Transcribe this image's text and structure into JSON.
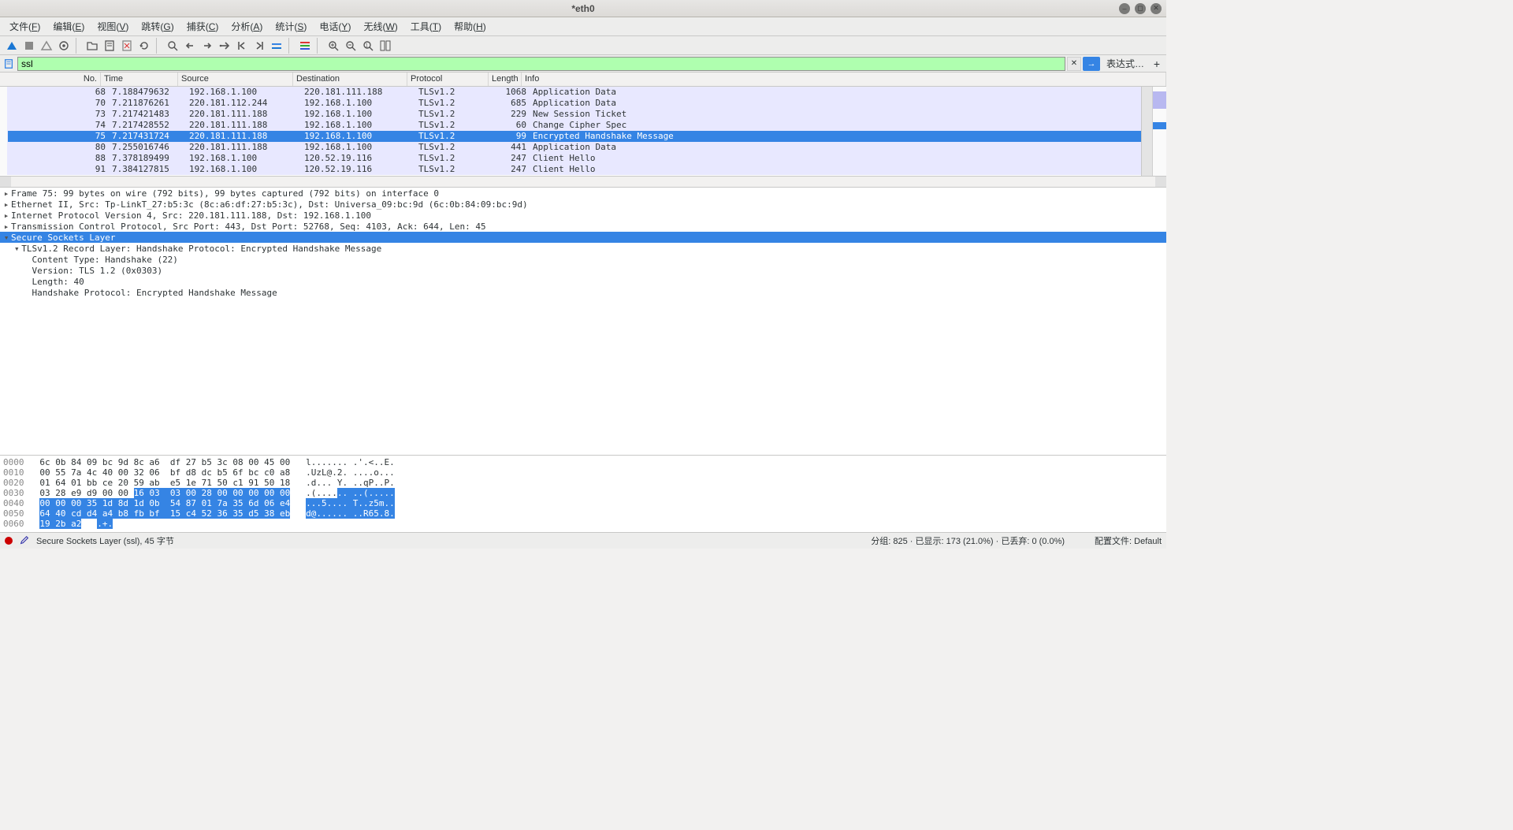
{
  "window": {
    "title": "*eth0"
  },
  "menu": [
    "文件(F)",
    "编辑(E)",
    "视图(V)",
    "跳转(G)",
    "捕获(C)",
    "分析(A)",
    "统计(S)",
    "电话(Y)",
    "无线(W)",
    "工具(T)",
    "帮助(H)"
  ],
  "filter": {
    "value": "ssl",
    "expr_label": "表达式…"
  },
  "packet_headers": [
    "No.",
    "Time",
    "Source",
    "Destination",
    "Protocol",
    "Length",
    "Info"
  ],
  "packets": [
    {
      "no": "68",
      "time": "7.188479632",
      "src": "192.168.1.100",
      "dst": "220.181.111.188",
      "proto": "TLSv1.2",
      "len": "1068",
      "info": "Application Data"
    },
    {
      "no": "70",
      "time": "7.211876261",
      "src": "220.181.112.244",
      "dst": "192.168.1.100",
      "proto": "TLSv1.2",
      "len": "685",
      "info": "Application Data"
    },
    {
      "no": "73",
      "time": "7.217421483",
      "src": "220.181.111.188",
      "dst": "192.168.1.100",
      "proto": "TLSv1.2",
      "len": "229",
      "info": "New Session Ticket"
    },
    {
      "no": "74",
      "time": "7.217428552",
      "src": "220.181.111.188",
      "dst": "192.168.1.100",
      "proto": "TLSv1.2",
      "len": "60",
      "info": "Change Cipher Spec"
    },
    {
      "no": "75",
      "time": "7.217431724",
      "src": "220.181.111.188",
      "dst": "192.168.1.100",
      "proto": "TLSv1.2",
      "len": "99",
      "info": "Encrypted Handshake Message",
      "selected": true
    },
    {
      "no": "80",
      "time": "7.255016746",
      "src": "220.181.111.188",
      "dst": "192.168.1.100",
      "proto": "TLSv1.2",
      "len": "441",
      "info": "Application Data"
    },
    {
      "no": "88",
      "time": "7.378189499",
      "src": "192.168.1.100",
      "dst": "120.52.19.116",
      "proto": "TLSv1.2",
      "len": "247",
      "info": "Client Hello"
    },
    {
      "no": "91",
      "time": "7.384127815",
      "src": "192.168.1.100",
      "dst": "120.52.19.116",
      "proto": "TLSv1.2",
      "len": "247",
      "info": "Client Hello"
    }
  ],
  "details": [
    {
      "ind": 0,
      "tw": "▸",
      "text": "Frame 75: 99 bytes on wire (792 bits), 99 bytes captured (792 bits) on interface 0"
    },
    {
      "ind": 0,
      "tw": "▸",
      "text": "Ethernet II, Src: Tp-LinkT_27:b5:3c (8c:a6:df:27:b5:3c), Dst: Universa_09:bc:9d (6c:0b:84:09:bc:9d)"
    },
    {
      "ind": 0,
      "tw": "▸",
      "text": "Internet Protocol Version 4, Src: 220.181.111.188, Dst: 192.168.1.100"
    },
    {
      "ind": 0,
      "tw": "▸",
      "text": "Transmission Control Protocol, Src Port: 443, Dst Port: 52768, Seq: 4103, Ack: 644, Len: 45"
    },
    {
      "ind": 0,
      "tw": "▾",
      "text": "Secure Sockets Layer",
      "sel": true
    },
    {
      "ind": 1,
      "tw": "▾",
      "text": "TLSv1.2 Record Layer: Handshake Protocol: Encrypted Handshake Message"
    },
    {
      "ind": 2,
      "tw": " ",
      "text": "Content Type: Handshake (22)"
    },
    {
      "ind": 2,
      "tw": " ",
      "text": "Version: TLS 1.2 (0x0303)"
    },
    {
      "ind": 2,
      "tw": " ",
      "text": "Length: 40"
    },
    {
      "ind": 2,
      "tw": " ",
      "text": "Handshake Protocol: Encrypted Handshake Message"
    }
  ],
  "bytes": [
    {
      "off": "0000",
      "hex": [
        "6c 0b 84 09 bc 9d 8c a6  df 27 b5 3c 08 00 45 00"
      ],
      "ascii": "l....... .'.<..E.",
      "sel": []
    },
    {
      "off": "0010",
      "hex": [
        "00 55 7a 4c 40 00 32 06  bf d8 dc b5 6f bc c0 a8"
      ],
      "ascii": ".UzL@.2. ....o...",
      "sel": []
    },
    {
      "off": "0020",
      "hex": [
        "01 64 01 bb ce 20 59 ab  e5 1e 71 50 c1 91 50 18"
      ],
      "ascii": ".d... Y. ..qP..P.",
      "sel": []
    },
    {
      "off": "0030",
      "hex": [
        "03 28 e9 d9 00 00 ",
        "16 03  03 00 28 00 00 00 00 00"
      ],
      "ascii": [
        ".(....",
        ".. ..(....."
      ],
      "p": 1
    },
    {
      "off": "0040",
      "hex": [
        "00 00 00 35 1d 8d 1d 0b  54 87 01 7a 35 6d 06 e4"
      ],
      "ascii": [
        "...5.... T..z5m.."
      ],
      "p": 2
    },
    {
      "off": "0050",
      "hex": [
        "64 40 cd d4 a4 b8 fb bf  15 c4 52 36 35 d5 38 eb"
      ],
      "ascii": [
        "d@...... ..R65.8."
      ],
      "p": 2
    },
    {
      "off": "0060",
      "hex": [
        "19 2b a2"
      ],
      "ascii": [
        ".+."
      ],
      "p": 2
    }
  ],
  "status": {
    "left": "Secure Sockets Layer (ssl), 45 字节",
    "mid": "分组: 825 · 已显示: 173 (21.0%) · 已丢弃: 0 (0.0%)",
    "right": "配置文件: Default"
  }
}
